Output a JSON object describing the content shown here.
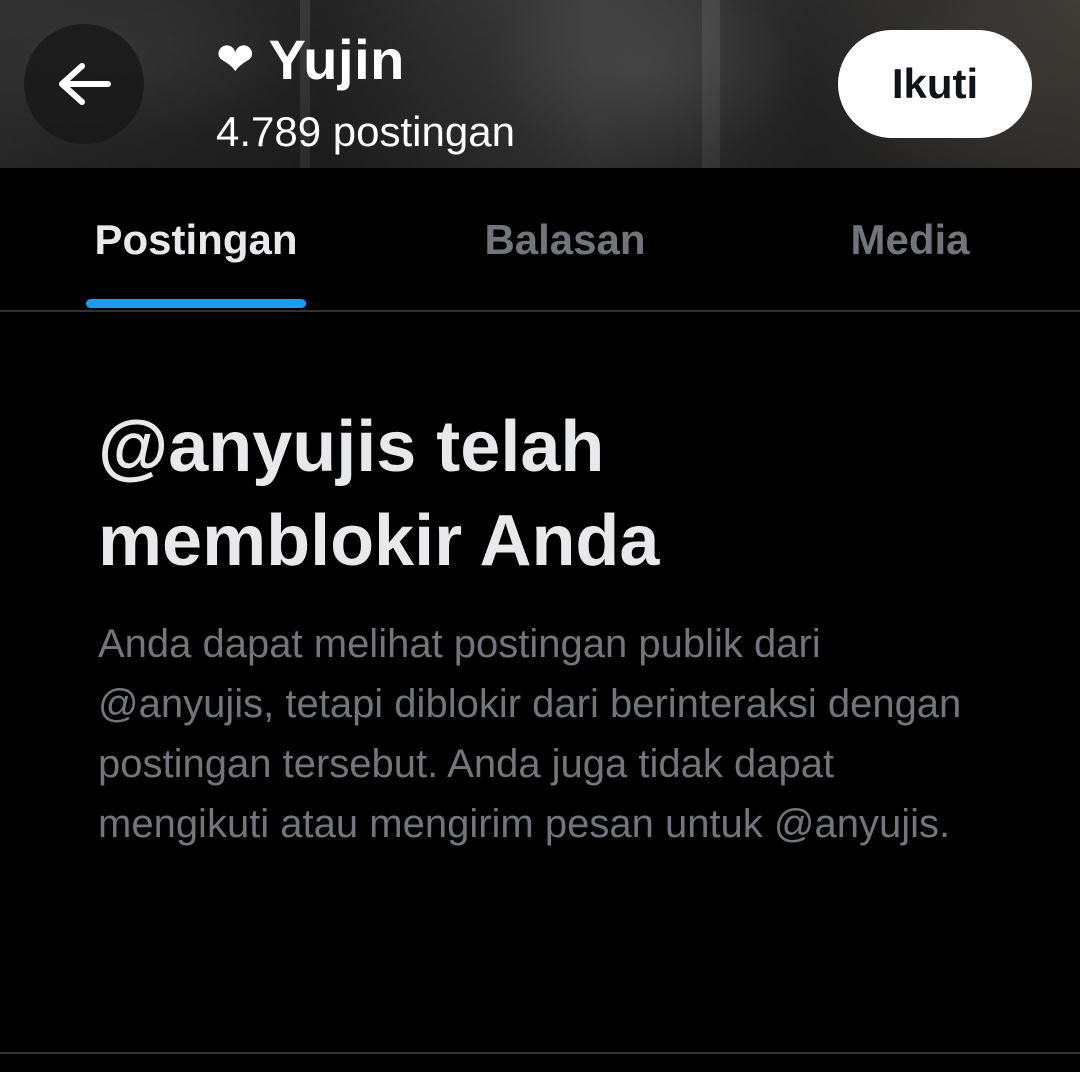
{
  "header": {
    "profile_name": "Yujin",
    "heart_symbol": "❤",
    "post_count": "4.789 postingan",
    "follow_label": "Ikuti",
    "back_icon": "arrow-left-icon"
  },
  "tabs": [
    {
      "label": "Postingan",
      "active": true
    },
    {
      "label": "Balasan",
      "active": false
    },
    {
      "label": "Media",
      "active": false
    }
  ],
  "blocked": {
    "title": "@anyujis telah memblokir Anda",
    "description": "Anda dapat melihat postingan publik dari @anyujis, tetapi diblokir dari berinteraksi dengan postingan tersebut. Anda juga tidak dapat mengikuti atau mengirim pesan untuk @anyujis."
  },
  "colors": {
    "accent": "#1d9bf0",
    "background": "#000000",
    "primary_text": "#e7e9ea",
    "secondary_text": "#71767b",
    "follow_button_bg": "#ffffff"
  }
}
